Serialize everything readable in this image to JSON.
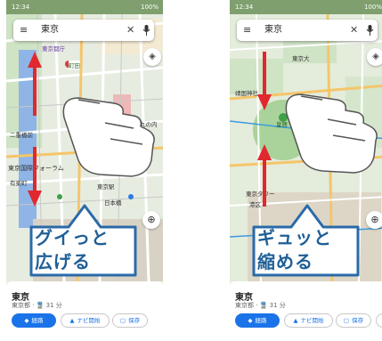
{
  "status_bar": {
    "time": "12:34",
    "battery": "100%"
  },
  "search": {
    "query": "東京",
    "menu_icon": "menu-icon",
    "clear_icon": "close-icon",
    "mic_icon": "mic-icon"
  },
  "map_labels": {
    "left": [
      "東京都庁",
      "町田",
      "二重橋前",
      "東京国際フォーラム",
      "有楽町",
      "東京駅",
      "日本橋",
      "丸の内"
    ],
    "right": [
      "東京大",
      "靖国神社",
      "皇居",
      "東京タワー",
      "港区"
    ]
  },
  "place": {
    "name": "東京",
    "subtitle": "東京都 · 🚆 31 分"
  },
  "actions": {
    "route": "経路",
    "navigate": "ナビ開始",
    "save": "保存"
  },
  "callouts": {
    "left": {
      "line1": "グイっと",
      "line2": "広げる"
    },
    "right": {
      "line1": "ギュッと",
      "line2": "縮める"
    }
  },
  "colors": {
    "accent": "#1a73e8",
    "arrow": "#e0282e",
    "callout_text": "#1f5f96",
    "callout_border": "#2a6aa8"
  }
}
